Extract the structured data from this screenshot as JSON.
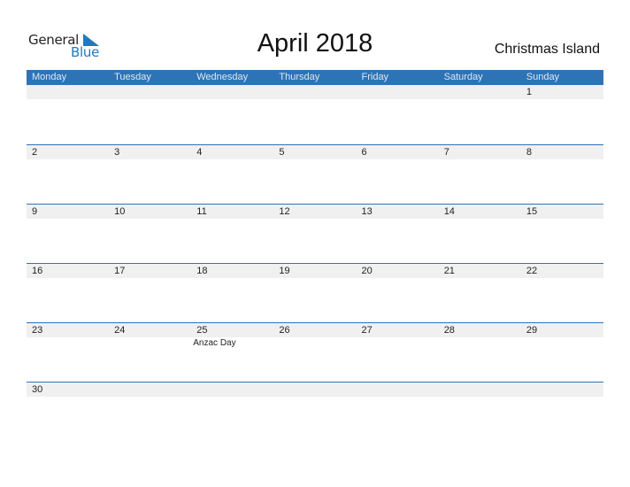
{
  "logo": {
    "line1": "General",
    "line2": "Blue",
    "icon": "triangle-flag-icon"
  },
  "title": "April 2018",
  "region": "Christmas Island",
  "colors": {
    "accent": "#2e73b5",
    "stripe": "#f0f0f0",
    "logo_blue": "#1f7ac0"
  },
  "weekdays": [
    "Monday",
    "Tuesday",
    "Wednesday",
    "Thursday",
    "Friday",
    "Saturday",
    "Sunday"
  ],
  "weeks": [
    {
      "days": [
        "",
        "",
        "",
        "",
        "",
        "",
        "1"
      ],
      "events": [
        "",
        "",
        "",
        "",
        "",
        "",
        ""
      ]
    },
    {
      "days": [
        "2",
        "3",
        "4",
        "5",
        "6",
        "7",
        "8"
      ],
      "events": [
        "",
        "",
        "",
        "",
        "",
        "",
        ""
      ]
    },
    {
      "days": [
        "9",
        "10",
        "11",
        "12",
        "13",
        "14",
        "15"
      ],
      "events": [
        "",
        "",
        "",
        "",
        "",
        "",
        ""
      ]
    },
    {
      "days": [
        "16",
        "17",
        "18",
        "19",
        "20",
        "21",
        "22"
      ],
      "events": [
        "",
        "",
        "",
        "",
        "",
        "",
        ""
      ]
    },
    {
      "days": [
        "23",
        "24",
        "25",
        "26",
        "27",
        "28",
        "29"
      ],
      "events": [
        "",
        "",
        "Anzac Day",
        "",
        "",
        "",
        ""
      ]
    },
    {
      "days": [
        "30",
        "",
        "",
        "",
        "",
        "",
        ""
      ],
      "events": [
        "",
        "",
        "",
        "",
        "",
        "",
        ""
      ]
    }
  ]
}
